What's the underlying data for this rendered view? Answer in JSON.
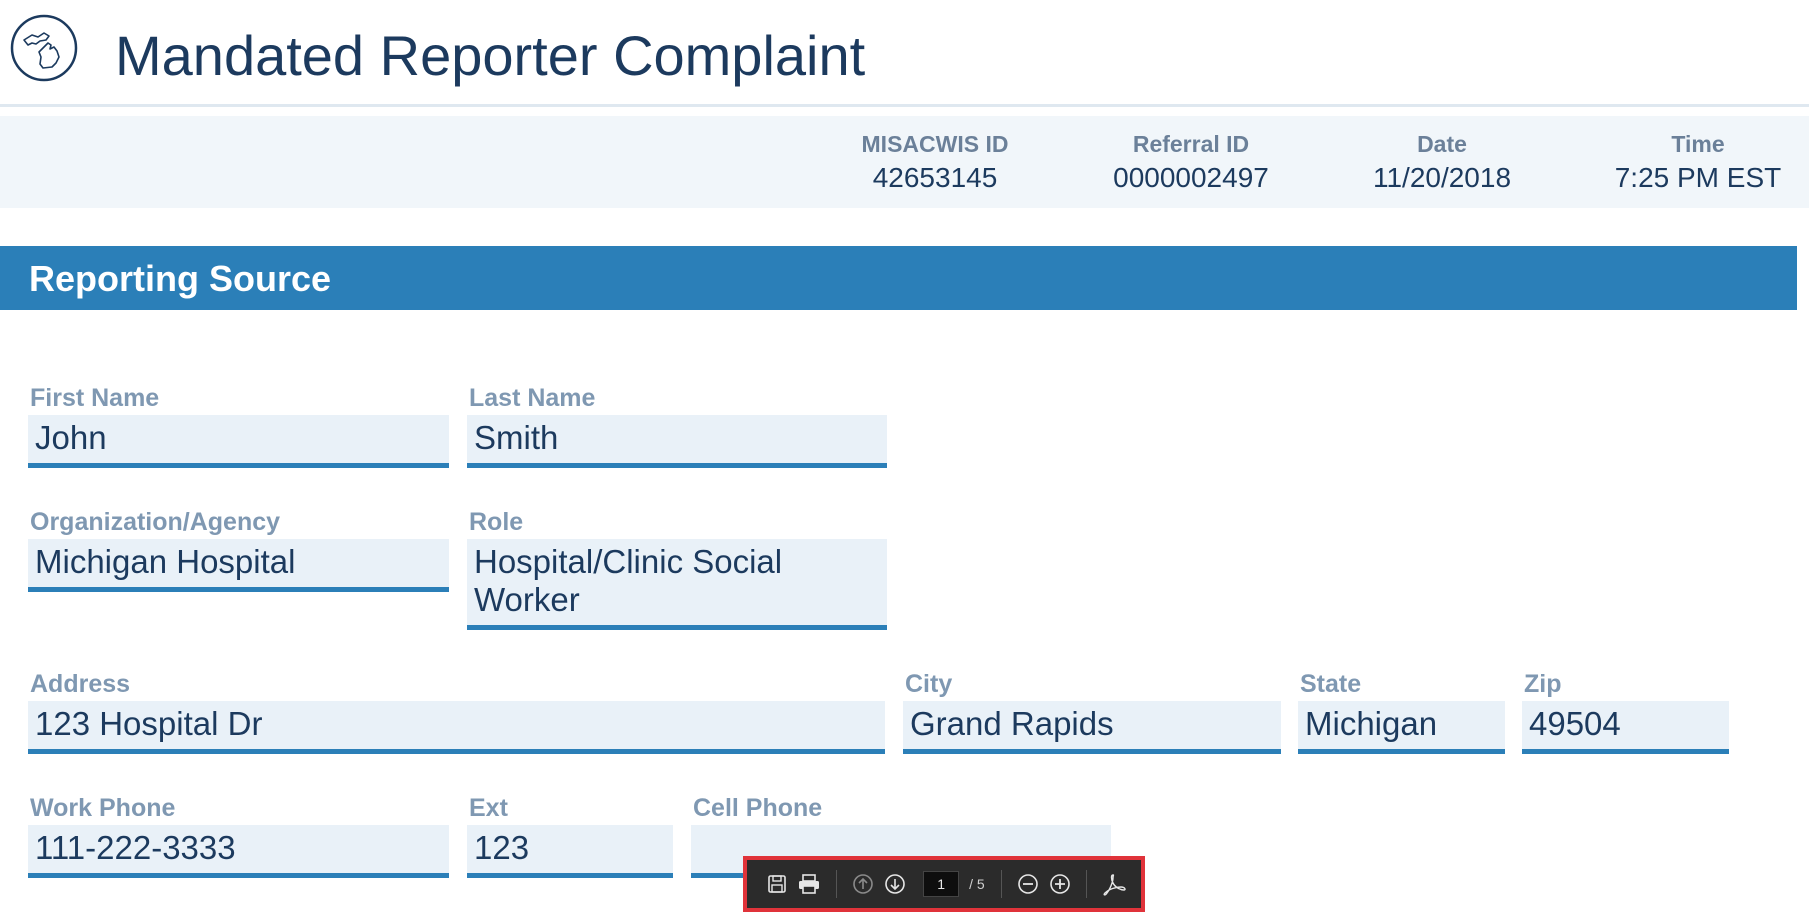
{
  "header": {
    "title": "Mandated Reporter Complaint",
    "logo_icon": "michigan-outline-icon"
  },
  "meta": {
    "items": [
      {
        "label": "MISACWIS ID",
        "value": "42653145"
      },
      {
        "label": "Referral ID",
        "value": "0000002497"
      },
      {
        "label": "Date",
        "value": "11/20/2018"
      },
      {
        "label": "Time",
        "value": "7:25 PM EST"
      }
    ]
  },
  "section": {
    "title": "Reporting Source"
  },
  "fields": {
    "first_name": {
      "label": "First Name",
      "value": "John"
    },
    "last_name": {
      "label": "Last Name",
      "value": "Smith"
    },
    "organization": {
      "label": "Organization/Agency",
      "value": "Michigan Hospital"
    },
    "role": {
      "label": "Role",
      "value": "Hospital/Clinic Social Worker"
    },
    "address": {
      "label": "Address",
      "value": "123 Hospital Dr"
    },
    "city": {
      "label": "City",
      "value": "Grand Rapids"
    },
    "state": {
      "label": "State",
      "value": "Michigan"
    },
    "zip": {
      "label": "Zip",
      "value": "49504"
    },
    "work_phone": {
      "label": "Work Phone",
      "value": "111-222-3333"
    },
    "ext": {
      "label": "Ext",
      "value": "123"
    },
    "cell_phone": {
      "label": "Cell Phone",
      "value": ""
    }
  },
  "pdf_toolbar": {
    "current_page": "1",
    "total_pages": "/ 5",
    "icons": [
      "save-icon",
      "print-icon",
      "page-up-icon",
      "page-down-icon",
      "zoom-out-icon",
      "zoom-in-icon",
      "acrobat-icon"
    ],
    "accent_color": "#e0333a"
  },
  "colors": {
    "brand_blue": "#2b7fb8",
    "title_navy": "#1c3a5e",
    "label_gray": "#7f98b2",
    "field_bg": "#e9f1f8"
  }
}
